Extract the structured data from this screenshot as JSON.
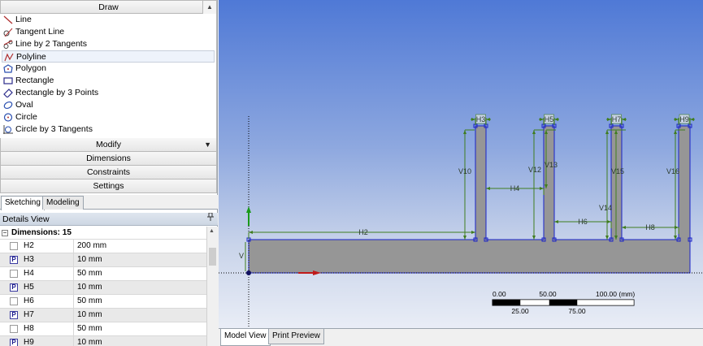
{
  "toolbox": {
    "draw_header": "Draw",
    "tools": [
      {
        "label": "Line",
        "icon": "line-icon"
      },
      {
        "label": "Tangent Line",
        "icon": "tangent-line-icon"
      },
      {
        "label": "Line by 2 Tangents",
        "icon": "line-by-2-tangents-icon"
      },
      {
        "label": "Polyline",
        "icon": "polyline-icon"
      },
      {
        "label": "Polygon",
        "icon": "polygon-icon"
      },
      {
        "label": "Rectangle",
        "icon": "rectangle-icon"
      },
      {
        "label": "Rectangle by 3 Points",
        "icon": "rectangle-3-points-icon"
      },
      {
        "label": "Oval",
        "icon": "oval-icon"
      },
      {
        "label": "Circle",
        "icon": "circle-icon"
      },
      {
        "label": "Circle by 3 Tangents",
        "icon": "circle-3-tangents-icon"
      }
    ],
    "selected_tool": "Polyline",
    "modify_header": "Modify",
    "dimensions_header": "Dimensions",
    "constraints_header": "Constraints",
    "settings_header": "Settings"
  },
  "tabs": {
    "sketching": "Sketching",
    "modeling": "Modeling",
    "active": "Sketching"
  },
  "details": {
    "title": "Details View",
    "group_label": "Dimensions: 15",
    "rows": [
      {
        "name": "H2",
        "value": "200 mm",
        "p": false
      },
      {
        "name": "H3",
        "value": "10 mm",
        "p": true
      },
      {
        "name": "H4",
        "value": "50 mm",
        "p": false
      },
      {
        "name": "H5",
        "value": "10 mm",
        "p": true
      },
      {
        "name": "H6",
        "value": "50 mm",
        "p": false
      },
      {
        "name": "H7",
        "value": "10 mm",
        "p": true
      },
      {
        "name": "H8",
        "value": "50 mm",
        "p": false
      },
      {
        "name": "H9",
        "value": "10 mm",
        "p": true
      }
    ]
  },
  "viewport": {
    "dimension_labels": [
      "H2",
      "H3",
      "H4",
      "H5",
      "H6",
      "H7",
      "H8",
      "H9",
      "V10",
      "V12",
      "V13",
      "V14",
      "V15",
      "V16",
      "V"
    ],
    "scale_bar": {
      "top_ticks": [
        "0.00",
        "50.00",
        "100.00 (mm)"
      ],
      "bottom_ticks": [
        "25.00",
        "75.00"
      ]
    },
    "colors": {
      "sketch_fill": "#969696",
      "dimension": "#3f7d1e",
      "edge": "#1a23c8"
    }
  },
  "bottom_tabs": {
    "model_view": "Model View",
    "print_preview": "Print Preview",
    "active": "Model View"
  },
  "icons": {
    "pin": "📌",
    "scroll_up": "▲",
    "dropdown": "▼",
    "collapse": "−",
    "p_marker": "P"
  }
}
